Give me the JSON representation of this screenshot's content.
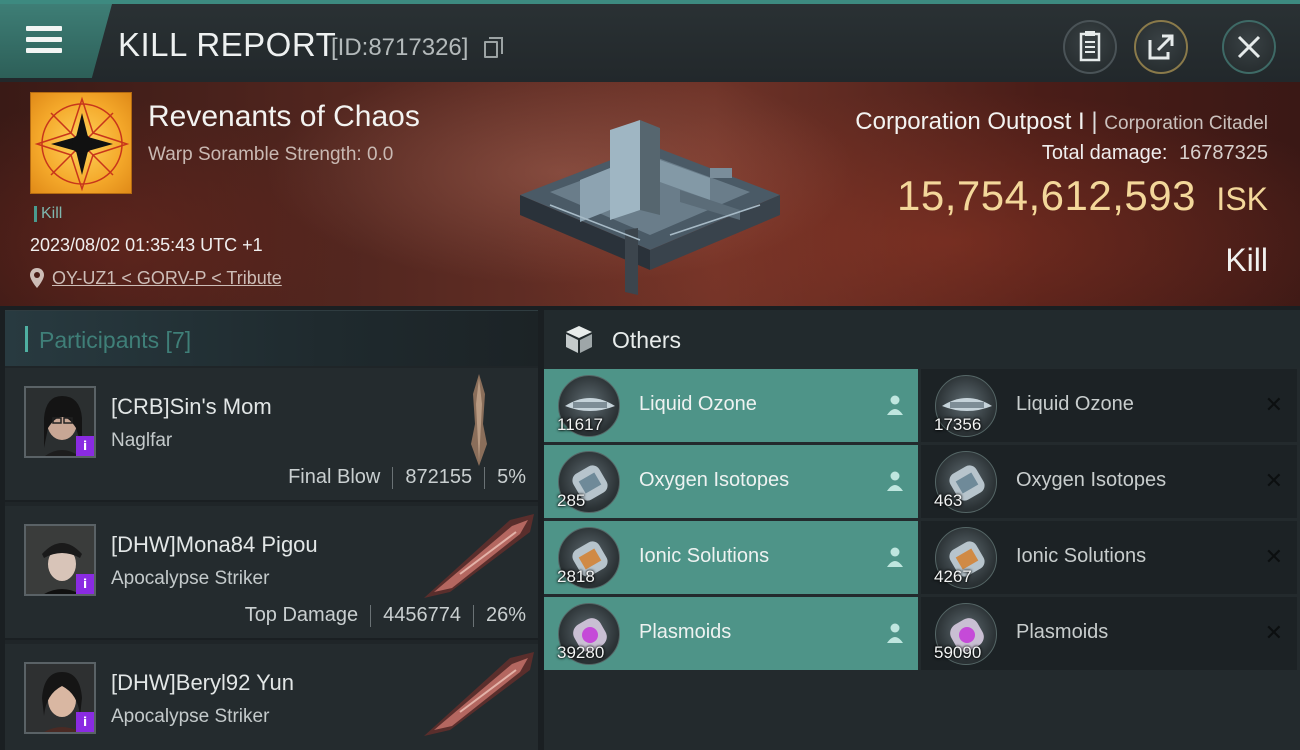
{
  "header": {
    "title": "KILL REPORT",
    "id_label": "[ID:8717326]",
    "menu_icon": "hamburger-menu-icon",
    "actions": [
      "clipboard-icon",
      "share-icon",
      "close-icon"
    ]
  },
  "victim": {
    "corporation": "Revenants of Chaos",
    "warp_scramble": "Warp Soramble Strength: 0.0",
    "kill_tag": "Kill",
    "timestamp": "2023/08/02 01:35:43 UTC +1",
    "location": "OY-UZ1 < GORV-P < Tribute",
    "ship_name": "Corporation Outpost I",
    "ship_separator": "|",
    "ship_class": "Corporation Citadel",
    "total_damage_label": "Total damage:",
    "total_damage_value": "16787325",
    "isk_value": "15,754,612,593",
    "isk_unit": "ISK",
    "outcome": "Kill"
  },
  "participants": {
    "title": "Participants [7]",
    "rows": [
      {
        "pilot": "[CRB]Sin's Mom",
        "ship": "Naglfar",
        "stat_label": "Final Blow",
        "damage": "872155",
        "percent": "5%"
      },
      {
        "pilot": "[DHW]Mona84 Pigou",
        "ship": "Apocalypse Striker",
        "stat_label": "Top Damage",
        "damage": "4456774",
        "percent": "26%"
      },
      {
        "pilot": "[DHW]Beryl92 Yun",
        "ship": "Apocalypse Striker"
      }
    ]
  },
  "others": {
    "title": "Others",
    "dropped": [
      {
        "name": "Liquid Ozone",
        "qty": "11617"
      },
      {
        "name": "Oxygen Isotopes",
        "qty": "285"
      },
      {
        "name": "Ionic Solutions",
        "qty": "2818"
      },
      {
        "name": "Plasmoids",
        "qty": "39280"
      }
    ],
    "destroyed": [
      {
        "name": "Liquid Ozone",
        "qty": "17356"
      },
      {
        "name": "Oxygen Isotopes",
        "qty": "463"
      },
      {
        "name": "Ionic Solutions",
        "qty": "4267"
      },
      {
        "name": "Plasmoids",
        "qty": "59090"
      }
    ]
  },
  "colors": {
    "accent": "#4e9488",
    "isk_gold": "#f3d79a",
    "badge_purple": "#8a2be2"
  }
}
